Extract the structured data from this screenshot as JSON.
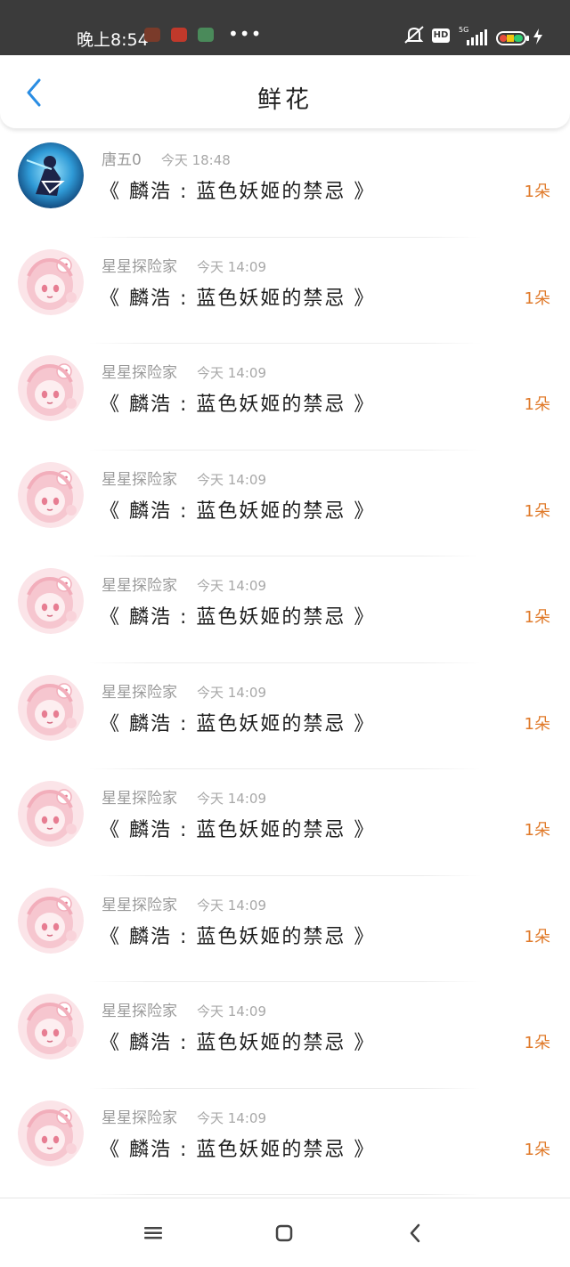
{
  "status_bar": {
    "time": "晚上8:54",
    "more": "•••",
    "hd_label": "HD",
    "network_label": "5G",
    "app_icons": [
      "app-icon-1",
      "app-icon-2",
      "app-icon-3"
    ],
    "right_icons": [
      "mute-icon",
      "hd-icon",
      "signal-icon",
      "battery-icon",
      "charging-icon"
    ]
  },
  "header": {
    "title": "鲜花",
    "back_icon": "chevron-left-icon",
    "accent_color": "#2a8de3"
  },
  "items": [
    {
      "user": "唐五0",
      "time": "今天 18:48",
      "title": "《 麟浩 : 蓝色妖姬的禁忌 》",
      "count": "1朵",
      "avatar": "avatar-dark-character"
    },
    {
      "user": "星星探险家",
      "time": "今天 14:09",
      "title": "《 麟浩 : 蓝色妖姬的禁忌 》",
      "count": "1朵",
      "avatar": "avatar-pink-character"
    },
    {
      "user": "星星探险家",
      "time": "今天 14:09",
      "title": "《 麟浩 : 蓝色妖姬的禁忌 》",
      "count": "1朵",
      "avatar": "avatar-pink-character"
    },
    {
      "user": "星星探险家",
      "time": "今天 14:09",
      "title": "《 麟浩 : 蓝色妖姬的禁忌 》",
      "count": "1朵",
      "avatar": "avatar-pink-character"
    },
    {
      "user": "星星探险家",
      "time": "今天 14:09",
      "title": "《 麟浩 : 蓝色妖姬的禁忌 》",
      "count": "1朵",
      "avatar": "avatar-pink-character"
    },
    {
      "user": "星星探险家",
      "time": "今天 14:09",
      "title": "《 麟浩 : 蓝色妖姬的禁忌 》",
      "count": "1朵",
      "avatar": "avatar-pink-character"
    },
    {
      "user": "星星探险家",
      "time": "今天 14:09",
      "title": "《 麟浩 : 蓝色妖姬的禁忌 》",
      "count": "1朵",
      "avatar": "avatar-pink-character"
    },
    {
      "user": "星星探险家",
      "time": "今天 14:09",
      "title": "《 麟浩 : 蓝色妖姬的禁忌 》",
      "count": "1朵",
      "avatar": "avatar-pink-character"
    },
    {
      "user": "星星探险家",
      "time": "今天 14:09",
      "title": "《 麟浩 : 蓝色妖姬的禁忌 》",
      "count": "1朵",
      "avatar": "avatar-pink-character"
    },
    {
      "user": "星星探险家",
      "time": "今天 14:09",
      "title": "《 麟浩 : 蓝色妖姬的禁忌 》",
      "count": "1朵",
      "avatar": "avatar-pink-character"
    }
  ],
  "colors": {
    "count_color": "#e07a2a",
    "meta_color": "#9a9a9a",
    "status_bar_bg": "#3b3b3b"
  },
  "nav_bar": {
    "icons": [
      "menu-icon",
      "home-icon",
      "back-icon"
    ]
  }
}
